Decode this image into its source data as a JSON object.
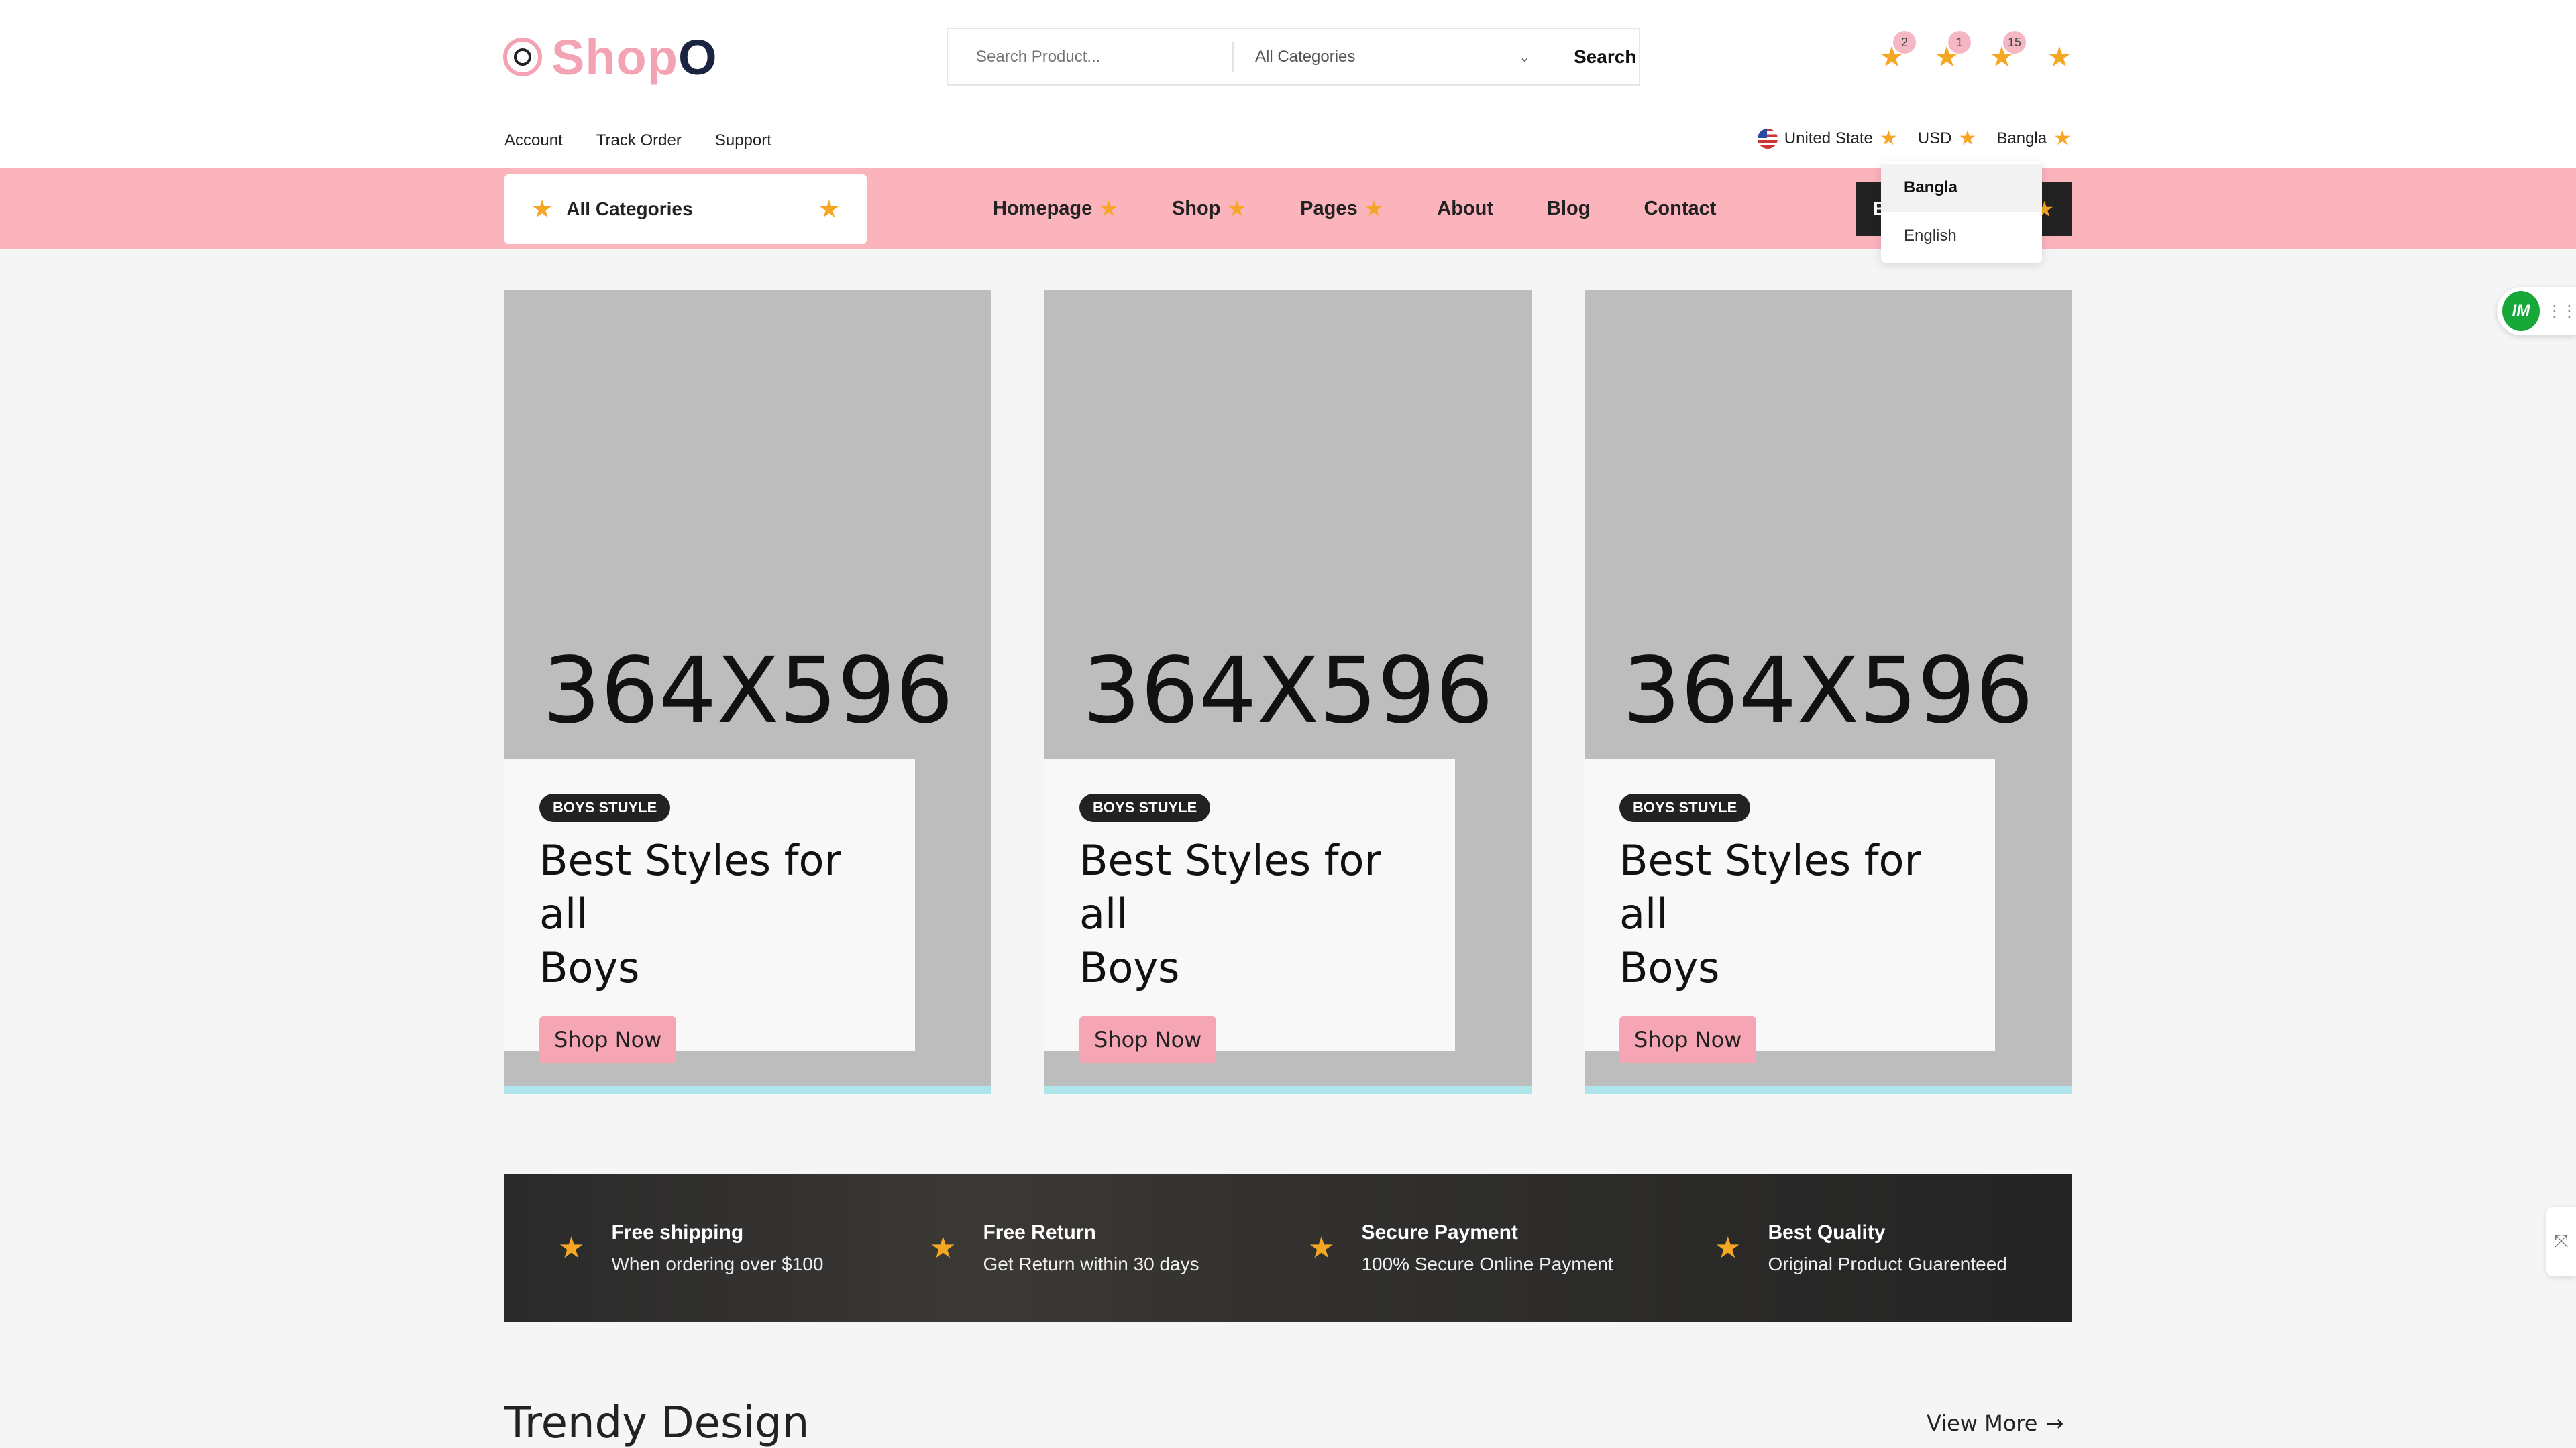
{
  "header": {
    "logo": {
      "text_main": "Shop",
      "text_accent": "O"
    },
    "search": {
      "placeholder": "Search Product...",
      "category": "All Categories",
      "button": "Search"
    },
    "icons": [
      {
        "name": "compare-icon",
        "badge": "2"
      },
      {
        "name": "wishlist-icon",
        "badge": "1"
      },
      {
        "name": "cart-icon",
        "badge": "15"
      },
      {
        "name": "user-icon",
        "badge": ""
      }
    ],
    "top_links": [
      "Account",
      "Track Order",
      "Support"
    ],
    "top_right": {
      "country": "United State",
      "currency": "USD",
      "language": "Bangla"
    }
  },
  "nav": {
    "all_categories": "All Categories",
    "items": [
      {
        "label": "Homepage",
        "has_dropdown": true
      },
      {
        "label": "Shop",
        "has_dropdown": true
      },
      {
        "label": "Pages",
        "has_dropdown": true
      },
      {
        "label": "About",
        "has_dropdown": false
      },
      {
        "label": "Blog",
        "has_dropdown": false
      },
      {
        "label": "Contact",
        "has_dropdown": false
      }
    ],
    "dark_button_initial": "B"
  },
  "language_dropdown": {
    "options": [
      "Bangla",
      "English"
    ],
    "selected": "Bangla"
  },
  "side_widget": {
    "logo_text": "IM"
  },
  "banners": [
    {
      "placeholder": "364X596",
      "tag": "BOYS STUYLE",
      "title_line1": "Best Styles for all",
      "title_line2": "Boys",
      "button": "Shop Now"
    },
    {
      "placeholder": "364X596",
      "tag": "BOYS STUYLE",
      "title_line1": "Best Styles for all",
      "title_line2": "Boys",
      "button": "Shop Now"
    },
    {
      "placeholder": "364X596",
      "tag": "BOYS STUYLE",
      "title_line1": "Best Styles for all",
      "title_line2": "Boys",
      "button": "Shop Now"
    }
  ],
  "features": [
    {
      "title": "Free shipping",
      "desc": "When ordering over $100"
    },
    {
      "title": "Free Return",
      "desc": "Get Return within 30 days"
    },
    {
      "title": "Secure Payment",
      "desc": "100% Secure Online Payment"
    },
    {
      "title": "Best Quality",
      "desc": "Original Product Guarenteed"
    }
  ],
  "trendy": {
    "title": "Trendy Design",
    "view_more": "View More"
  },
  "colors": {
    "brand_pink": "#fbb3bc",
    "accent_star": "#f5a623",
    "dark": "#222222",
    "button_pink": "#f5a5b3"
  }
}
